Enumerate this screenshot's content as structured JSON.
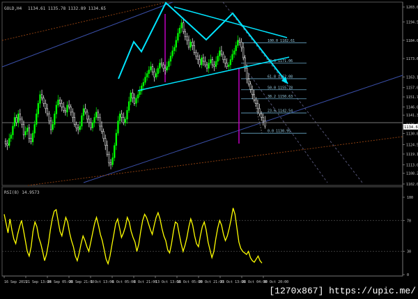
{
  "header": {
    "symbol": "GOLD,H4",
    "ohlc": "1134.61  1135.78  1132.89  1134.65"
  },
  "rsi_title": "RSI(8) 14.9573",
  "watermark": "[1270x867] https://upic.me/",
  "colors": {
    "background": "#000000",
    "bull_candle": "#00ff00",
    "bear_candle": "#ffffff",
    "rsi_line": "#ffff00",
    "pattern_lines": "#00e5ff",
    "channel_blue": "#3a4fa8",
    "channel_orange": "#8a3e10",
    "fibo_lines": "#6aa9c8",
    "marker_magenta": "#c000c0"
  },
  "chart_data": [
    {
      "type": "line",
      "title": "GOLD,H4",
      "ylim": [
        1102.0,
        1205.0
      ],
      "y_ticks": [
        "1203.0",
        "1194.5",
        "1184.0",
        "1173.6",
        "1163.1",
        "1157.0",
        "1151.7",
        "1146.0",
        "1141.3",
        "1136.0",
        "1130.8",
        "1124.5",
        "1119.1",
        "1113.0",
        "1108.2",
        "1102.0"
      ],
      "x_ticks": [
        "16 Sep 2015",
        "21 Sep 13:00",
        "24 Sep 05:00",
        "28 Sep 21:00",
        "1 Oct 13:00",
        "6 Oct 05:00",
        "8 Oct 21:00",
        "13 Oct 13:00",
        "16 Oct 05:00",
        "20 Oct 21:00",
        "23 Oct 13:00",
        "28 Oct 04:00",
        "30 Oct 20:00"
      ],
      "current_price": "1134.65",
      "series": [
        {
          "name": "",
          "values": [
            1125,
            1124,
            1128,
            1130,
            1135,
            1140,
            1137,
            1142,
            1139,
            1136,
            1130,
            1132,
            1134,
            1128,
            1126,
            1131,
            1136,
            1142,
            1148,
            1153,
            1151,
            1148,
            1145,
            1142,
            1138,
            1133,
            1136,
            1142,
            1147,
            1150,
            1148,
            1146,
            1144,
            1143,
            1147,
            1146,
            1143,
            1140,
            1136,
            1134,
            1133,
            1135,
            1141,
            1145,
            1143,
            1139,
            1137,
            1134,
            1137,
            1140,
            1143,
            1140,
            1135,
            1132,
            1128,
            1124,
            1119,
            1114,
            1113,
            1117,
            1124,
            1131,
            1138,
            1142,
            1140,
            1137,
            1139,
            1144,
            1149,
            1154,
            1151,
            1148,
            1151,
            1153,
            1155,
            1158,
            1160,
            1163,
            1165,
            1167,
            1169,
            1166,
            1163,
            1165,
            1168,
            1171,
            1170,
            1168,
            1167,
            1169,
            1172,
            1175,
            1178,
            1180,
            1184,
            1188,
            1191,
            1194,
            1189,
            1186,
            1184,
            1180,
            1183,
            1181,
            1177,
            1175,
            1173,
            1170,
            1174,
            1172,
            1170,
            1168,
            1171,
            1173,
            1170,
            1169,
            1172,
            1175,
            1178,
            1176,
            1173,
            1171,
            1169,
            1170,
            1173,
            1176,
            1178,
            1181,
            1184,
            1183,
            1180,
            1174,
            1168,
            1162,
            1159,
            1156,
            1153,
            1150,
            1148,
            1145,
            1142,
            1140,
            1138,
            1135
          ]
        }
      ],
      "fibonacci_levels": [
        {
          "label": "100.0 1182.61",
          "value": 1182.61
        },
        {
          "label": "78.6 1171.06",
          "value": 1171.06
        },
        {
          "label": "61.8 1162.08",
          "value": 1162.08
        },
        {
          "label": "50.0 1155.78",
          "value": 1155.78
        },
        {
          "label": "38.2 1150.63",
          "value": 1150.63
        },
        {
          "label": "23.6 1142.54",
          "value": 1142.54
        },
        {
          "label": "0.0 1130.95",
          "value": 1130.95
        }
      ]
    },
    {
      "type": "line",
      "title": "RSI(8) 14.9573",
      "ylim": [
        0,
        100
      ],
      "y_ticks": [
        "100",
        "70",
        "30",
        "0"
      ],
      "series": [
        {
          "name": "RSI(8)",
          "values": [
            78,
            66,
            54,
            72,
            58,
            46,
            40,
            52,
            62,
            70,
            58,
            44,
            30,
            24,
            36,
            56,
            68,
            62,
            48,
            40,
            30,
            18,
            26,
            40,
            58,
            72,
            82,
            84,
            70,
            56,
            50,
            62,
            74,
            68,
            54,
            44,
            36,
            24,
            18,
            28,
            40,
            50,
            44,
            36,
            30,
            42,
            54,
            66,
            74,
            64,
            52,
            44,
            32,
            20,
            14,
            24,
            38,
            52,
            66,
            72,
            60,
            48,
            54,
            62,
            74,
            68,
            56,
            48,
            42,
            30,
            40,
            56,
            70,
            78,
            74,
            66,
            58,
            52,
            64,
            74,
            80,
            72,
            60,
            50,
            44,
            32,
            28,
            40,
            56,
            68,
            66,
            52,
            40,
            30,
            38,
            48,
            62,
            72,
            64,
            50,
            40,
            36,
            50,
            62,
            68,
            58,
            42,
            32,
            22,
            30,
            46,
            60,
            70,
            64,
            52,
            44,
            50,
            60,
            72,
            86,
            78,
            60,
            42,
            34,
            30,
            28,
            26,
            30,
            22,
            18,
            16,
            20,
            24,
            18,
            15
          ]
        }
      ]
    }
  ]
}
